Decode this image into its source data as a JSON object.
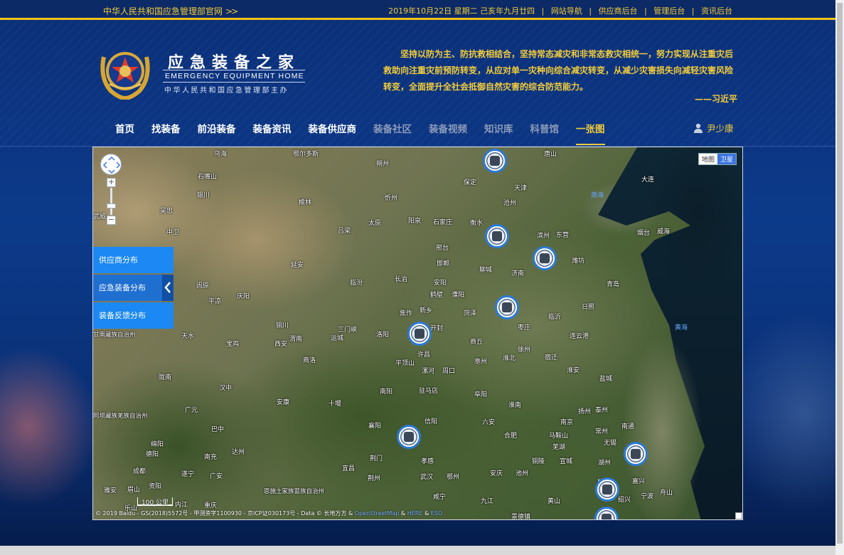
{
  "topbar": {
    "official_link": "中华人民共和国应急管理部官网",
    "arrows": ">>",
    "date": "2019年10月22日 星期二 己亥年九月廿四",
    "links": [
      "网站导航",
      "供应商后台",
      "管理后台",
      "资讯后台"
    ]
  },
  "logo": {
    "title": "应急装备之家",
    "english": "EMERGENCY EQUIPMENT HOME",
    "sponsor": "中华人民共和国应急管理部主办"
  },
  "quote": {
    "text": "坚持以防为主、防抗救相结合，坚持常态减灾和非常态救灾相统一，努力实现从注重灾后救助向注重灾前预防转变，从应对单一灾种向综合减灾转变，从减少灾害损失向减轻灾害风险转变，全面提升全社会抵御自然灾害的综合防范能力。",
    "author": "——习近平"
  },
  "nav": {
    "items": [
      {
        "label": "首页",
        "state": "normal"
      },
      {
        "label": "找装备",
        "state": "normal"
      },
      {
        "label": "前沿装备",
        "state": "normal"
      },
      {
        "label": "装备资讯",
        "state": "normal"
      },
      {
        "label": "装备供应商",
        "state": "normal"
      },
      {
        "label": "装备社区",
        "state": "dim"
      },
      {
        "label": "装备视频",
        "state": "dim"
      },
      {
        "label": "知识库",
        "state": "dim"
      },
      {
        "label": "科普馆",
        "state": "dim"
      },
      {
        "label": "一张图",
        "state": "active"
      }
    ],
    "user": "尹少康"
  },
  "map": {
    "type_buttons": [
      "地图",
      "卫星"
    ],
    "active_type": "卫星",
    "side_panel": [
      "供应商分布",
      "应急装备分布",
      "装备反馈分布"
    ],
    "selected_panel": "应急装备分布",
    "scale": "100 公里",
    "copyright": "© 2019 Baidu - GS(2018)5572号 - 甲测资字1100930 - 京ICP证030173号 - Data © 长地万方 &",
    "copyright_links": [
      "OpenStreetMap",
      "HERE",
      "ESO"
    ],
    "copyright_sep": "&",
    "labels": {
      "wuhai": "乌海",
      "eerduosi": "鄂尔多斯",
      "shuozhou": "朔州",
      "baoding": "保定",
      "tangshan": "唐山",
      "tianjin": "天津",
      "dalian": "大连",
      "bohai": "渤海",
      "shizuishan": "石嘴山",
      "yinchuan": "银川",
      "yulin": "榆林",
      "xinzhou": "忻州",
      "cangzhou": "沧州",
      "yantai": "烟台",
      "weihai": "威海",
      "wuwei": "武威",
      "zhongwei": "中卫",
      "taiyuan": "太原",
      "yangquan": "阳泉",
      "shijiazhuang": "石家庄",
      "hengshui": "衡水",
      "binzhou": "滨州",
      "dongying": "东营",
      "lvliang": "吕梁",
      "xingtai": "邢台",
      "weifang": "潍坊",
      "yanan": "延安",
      "handan": "邯郸",
      "liaocheng": "聊城",
      "jinan": "济南",
      "guyuan": "固原",
      "changzhi": "长治",
      "anyang": "安阳",
      "qingdao": "青岛",
      "pingliang": "平凉",
      "qingyang": "庆阳",
      "linfen": "临汾",
      "hebi": "鹤壁",
      "puyang": "濮阳",
      "jiaozuo": "焦作",
      "xinxiang": "新乡",
      "heze": "菏泽",
      "linyi": "临沂",
      "rizhao": "日照",
      "huanghai": "黄海",
      "tongchuan": "铜川",
      "yuncheng": "运城",
      "sanmenxia": "三门峡",
      "luoyang": "洛阳",
      "kaifeng": "开封",
      "zaozhuang": "枣庄",
      "tianshui": "天水",
      "baoji": "宝鸡",
      "xian": "西安",
      "weinan": "渭南",
      "xuchang": "许昌",
      "shangqiu": "商丘",
      "xuzhou": "徐州",
      "lianyungang": "连云港",
      "gannan": "甘南藏族自治州",
      "shangluo": "商洛",
      "pingdingshan": "平顶山",
      "luohe": "漯河",
      "zhoukou": "周口",
      "bozhou": "亳州",
      "huaibei": "淮北",
      "suqian": "宿迁",
      "longnan": "陇南",
      "hanzhong": "汉中",
      "nanyang": "南阳",
      "zhumadian": "驻马店",
      "fuyang": "阜阳",
      "huainan": "淮南",
      "yancheng": "盐城",
      "huaian": "淮安",
      "aba": "阿坝藏族羌族自治州",
      "guangyuan": "广元",
      "ankang": "安康",
      "shiyan": "十堰",
      "xinyang": "信阳",
      "liuan": "六安",
      "nanjing": "南京",
      "yangzhou": "扬州",
      "taizhou": "泰州",
      "nantong": "南通",
      "bazhong": "巴中",
      "xiangyang": "襄阳",
      "hefei": "合肥",
      "maanshan": "马鞍山",
      "changzhou": "常州",
      "mianyang": "绵阳",
      "dazhou": "达州",
      "jingmen": "荆门",
      "xiaogan": "孝感",
      "wuhu": "芜湖",
      "wuxi": "无锡",
      "deyang": "德阳",
      "nanchong": "南充",
      "tongling": "铜陵",
      "xuancheng": "宣城",
      "huzhou": "湖州",
      "suining": "遂宁",
      "guangan": "广安",
      "yichang": "宜昌",
      "jingzhou": "荆州",
      "wuhan": "武汉",
      "ezhou": "鄂州",
      "anqing": "安庆",
      "chizhou": "池州",
      "hangzhou": "杭州",
      "chengdu": "成都",
      "ya_an": "雅安",
      "meishan": "眉山",
      "ziyang": "资阳",
      "enshi": "恩施土家族苗族自治州",
      "xianning": "咸宁",
      "jiujiang": "九江",
      "huangshan": "黄山",
      "ningbo": "宁波",
      "zhoushan": "舟山",
      "leshan": "乐山",
      "neijiang": "内江",
      "chongqing": "重庆",
      "jingdezhen": "景德镇",
      "shaoxing": "绍兴",
      "jiaxing": "嘉兴",
      "wuzhong": "吴忠"
    }
  },
  "colors": {
    "accent_gold": "#f3cc3a",
    "panel_blue": "#1b88f3",
    "header_blue": "#0b2f78"
  }
}
